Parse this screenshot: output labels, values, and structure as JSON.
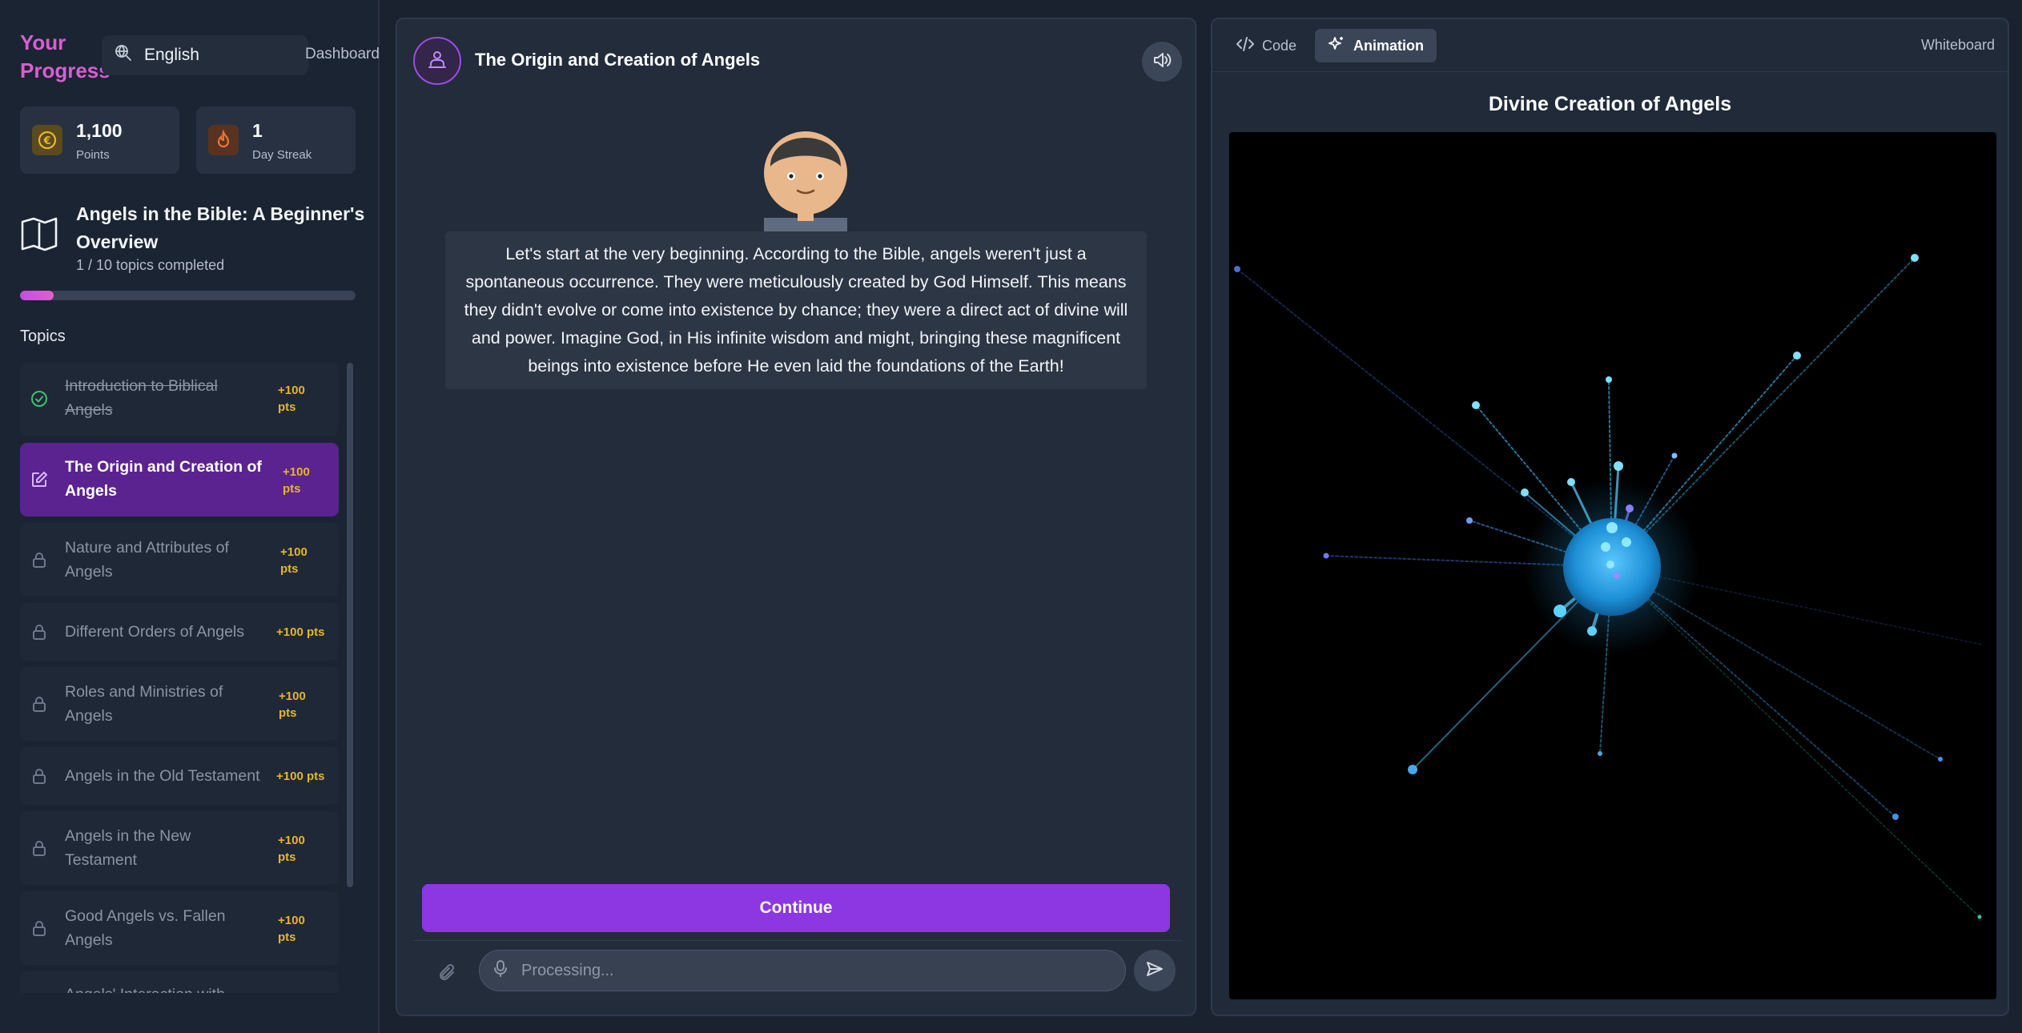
{
  "sidebar": {
    "title": "Your Progress",
    "language": "English",
    "dashboard_link": "Dashboard",
    "stats": {
      "points": {
        "value": "1,100",
        "label": "Points",
        "icon": "coin-icon",
        "color": "#e7b52a"
      },
      "streak": {
        "value": "1",
        "label": "Day Streak",
        "icon": "flame-icon",
        "color": "#e7763a"
      }
    },
    "course": {
      "title": "Angels in the Bible: A Beginner's Overview",
      "progress_text": "1 / 10 topics completed",
      "progress_fraction": 0.1
    },
    "topics_heading": "Topics",
    "topics": [
      {
        "label": "Introduction to Biblical Angels",
        "points": "+100 pts",
        "status": "completed"
      },
      {
        "label": "The Origin and Creation of Angels",
        "points": "+100 pts",
        "status": "active"
      },
      {
        "label": "Nature and Attributes of Angels",
        "points": "+100 pts",
        "status": "locked"
      },
      {
        "label": "Different Orders of Angels",
        "points": "+100 pts",
        "status": "locked"
      },
      {
        "label": "Roles and Ministries of Angels",
        "points": "+100 pts",
        "status": "locked"
      },
      {
        "label": "Angels in the Old Testament",
        "points": "+100 pts",
        "status": "locked"
      },
      {
        "label": "Angels in the New Testament",
        "points": "+100 pts",
        "status": "locked"
      },
      {
        "label": "Good Angels vs. Fallen Angels",
        "points": "+100 pts",
        "status": "locked"
      },
      {
        "label": "Angels' Interaction with",
        "points": "",
        "status": "locked"
      }
    ]
  },
  "chat": {
    "title": "The Origin and Creation of Angels",
    "message": "Let's start at the very beginning. According to the Bible, angels weren't just a spontaneous occurrence. They were meticulously created by God Himself. This means they didn't evolve or come into existence by chance; they were a direct act of divine will and power. Imagine God, in His infinite wisdom and might, bringing these magnificent beings into existence before He even laid the foundations of the Earth!",
    "continue_label": "Continue",
    "input_placeholder": "Processing..."
  },
  "panel": {
    "tabs": [
      {
        "label": "Code",
        "icon": "code-icon",
        "active": false
      },
      {
        "label": "Animation",
        "icon": "sparkle-icon",
        "active": true
      }
    ],
    "whiteboard_label": "Whiteboard",
    "animation_title": "Divine Creation of Angels"
  },
  "colors": {
    "accent": "#8c37e2",
    "active_topic": "#5b2390",
    "points": "#e7b52a",
    "completed": "#3fbf73",
    "orb": "#2ea2e6"
  }
}
